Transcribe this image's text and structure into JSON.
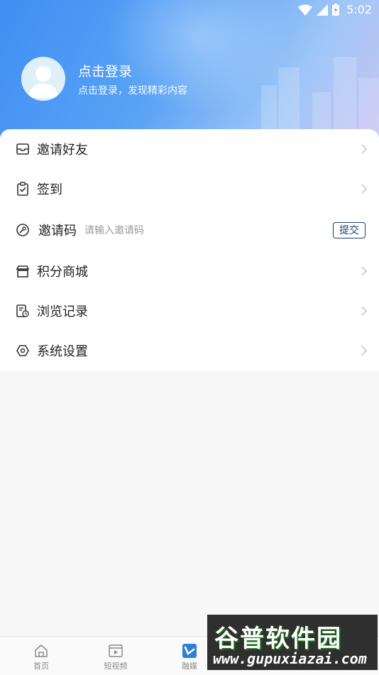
{
  "status": {
    "time": "5:02"
  },
  "profile": {
    "title": "点击登录",
    "subtitle": "点击登录，发现精彩内容"
  },
  "menu": {
    "invite_friends": "邀请好友",
    "sign_in": "签到",
    "invite_code": {
      "label": "邀请码",
      "placeholder": "请输入邀请码",
      "submit": "提交"
    },
    "points_mall": "积分商城",
    "history": "浏览记录",
    "settings": "系统设置"
  },
  "tabs": [
    {
      "label": "首页",
      "icon": "home-icon"
    },
    {
      "label": "短视频",
      "icon": "video-icon"
    },
    {
      "label": "融媒",
      "icon": "media-icon"
    },
    {
      "label": "",
      "icon": "tab4-icon"
    },
    {
      "label": "",
      "icon": "tab5-icon"
    }
  ],
  "watermark": {
    "title": "谷普软件园",
    "url": "www.gupuxiazai.com"
  },
  "colors": {
    "accent": "#3f8ef3",
    "button_border": "#1f3d74"
  }
}
